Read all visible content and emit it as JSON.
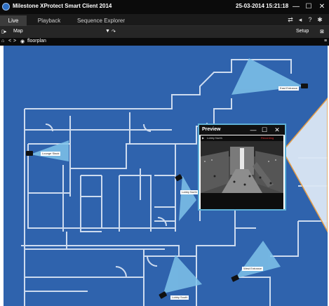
{
  "app": {
    "title": "Milestone XProtect Smart Client 2014",
    "datetime": "25-03-2014 15:21:18",
    "minimize_glyph": "—",
    "maximize_glyph": "☐",
    "close_glyph": "✕"
  },
  "tabs": [
    {
      "label": "Live",
      "active": true
    },
    {
      "label": "Playback",
      "active": false
    },
    {
      "label": "Sequence Explorer",
      "active": false
    }
  ],
  "toolbar": {
    "view_label": "Map",
    "setup_label": "Setup"
  },
  "breadcrumb": {
    "back_glyph": "<",
    "forward_glyph": ">",
    "map_name": "floorplan"
  },
  "cameras": [
    {
      "label": "Lounge Stack"
    },
    {
      "label": "Lobby North"
    },
    {
      "label": "East Entrance"
    },
    {
      "label": "West Entrance"
    },
    {
      "label": "Lobby South"
    }
  ],
  "preview": {
    "title": "Preview",
    "camera_name": "Lobby North",
    "status": "Recording",
    "minimize_glyph": "—",
    "maximize_glyph": "☐",
    "close_glyph": "✕"
  },
  "colors": {
    "map_background": "#2f63ad",
    "wall_lines": "#dfe9f7",
    "camera_fov": "#7fc3ea",
    "preview_border": "#5fb0d6",
    "recording_status": "#e03030"
  }
}
